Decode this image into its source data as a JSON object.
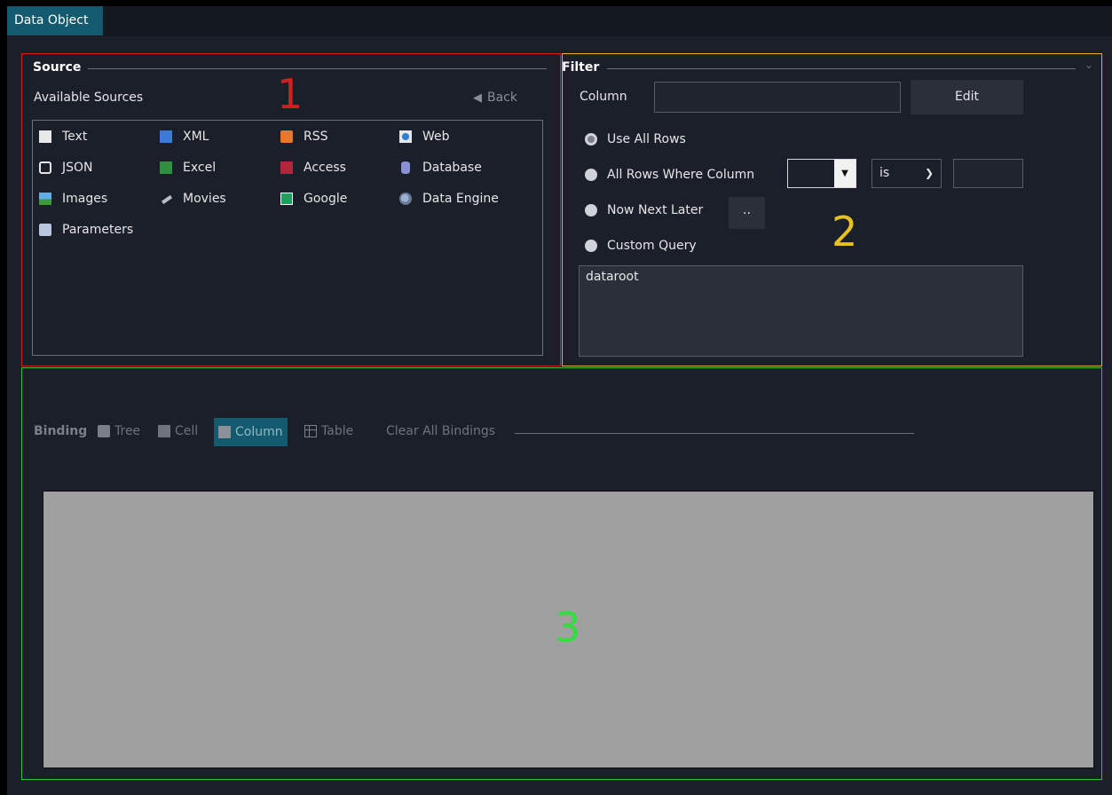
{
  "tab": {
    "label": "Data Object"
  },
  "source": {
    "title": "Source",
    "available_label": "Available Sources",
    "back_label": "Back",
    "marker": "1",
    "items": [
      {
        "label": "Text",
        "icon": "text-file-icon"
      },
      {
        "label": "XML",
        "icon": "xml-icon"
      },
      {
        "label": "RSS",
        "icon": "rss-icon"
      },
      {
        "label": "Web",
        "icon": "web-icon"
      },
      {
        "label": "JSON",
        "icon": "json-icon"
      },
      {
        "label": "Excel",
        "icon": "excel-icon"
      },
      {
        "label": "Access",
        "icon": "access-icon"
      },
      {
        "label": "Database",
        "icon": "database-icon"
      },
      {
        "label": "Images",
        "icon": "images-icon"
      },
      {
        "label": "Movies",
        "icon": "movies-icon"
      },
      {
        "label": "Google",
        "icon": "google-sheets-icon"
      },
      {
        "label": "Data Engine",
        "icon": "data-engine-icon"
      },
      {
        "label": "Parameters",
        "icon": "parameters-icon"
      }
    ]
  },
  "filter": {
    "title": "Filter",
    "marker": "2",
    "column_label": "Column",
    "column_value": "",
    "edit_label": "Edit",
    "options": {
      "use_all": "Use All Rows",
      "rows_where": "All Rows Where Column",
      "now_next": "Now Next Later",
      "custom": "Custom Query"
    },
    "selected_option": "Use All Rows",
    "operator_value": "is",
    "compare_value": "",
    "dots_label": "..",
    "query_text": "dataroot"
  },
  "binding": {
    "title": "Binding",
    "marker": "3",
    "modes": [
      "Tree",
      "Cell",
      "Column",
      "Table"
    ],
    "active_mode": "Column",
    "clear_label": "Clear All Bindings"
  },
  "colors": {
    "box1": "#d21f1f",
    "box2": "#e2b52a",
    "box3": "#29c43e",
    "active": "#145a6e"
  }
}
